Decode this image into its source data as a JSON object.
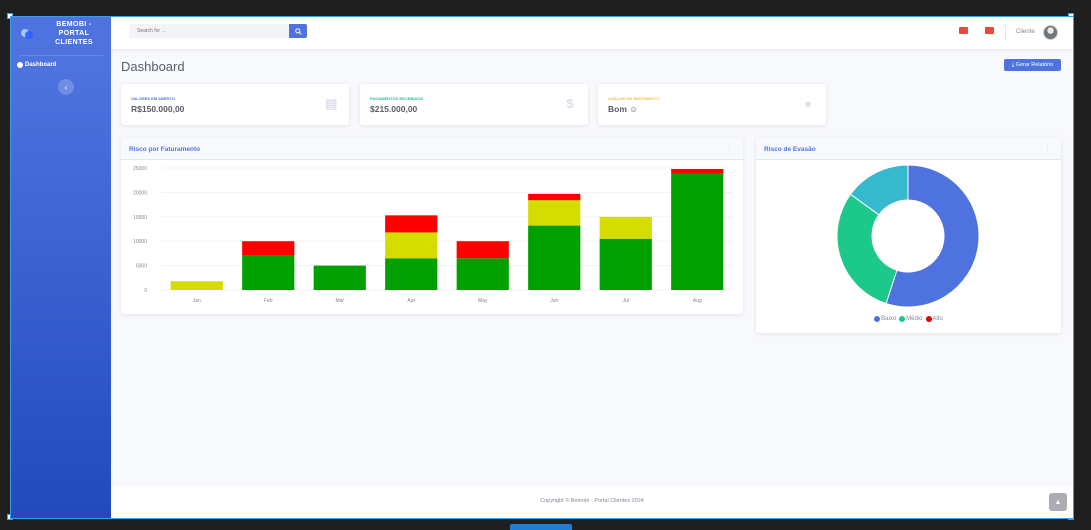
{
  "sidebar": {
    "brand": "BEMOBI - PORTAL CLIENTES",
    "nav_items": [
      {
        "label": "Dashboard",
        "icon": "dashboard-icon",
        "active": true
      }
    ],
    "toggle_icon": "chevron-left-icon"
  },
  "topbar": {
    "search_placeholder": "Search for ...",
    "user_name": "Cliente",
    "icons": [
      "search-icon",
      "alert-icon",
      "message-icon"
    ]
  },
  "header": {
    "title": "Dashboard",
    "report_button": "⤓ Gerar Relatório"
  },
  "kpis": [
    {
      "label": "VALORES EM ABERTO",
      "value": "R$150.000,00",
      "icon": "calendar-icon",
      "color": "#4e73df"
    },
    {
      "label": "PAGAMENTOS RECEBIDOS",
      "value": "$215.000,00",
      "icon": "dollar-icon",
      "color": "#1cc88a"
    },
    {
      "label": "ANÁLISE DE SENTIMENTO",
      "value": "Bom ☺",
      "icon": "comments-icon",
      "color": "#f6c23e"
    }
  ],
  "bar_panel": {
    "title": "Risco por Faturamento",
    "menu": "⋮"
  },
  "donut_panel": {
    "title": "Risco de Evasão",
    "menu": "⋮"
  },
  "chart_data": [
    {
      "type": "bar",
      "stacked": true,
      "title": "Risco por Faturamento",
      "categories": [
        "Jan",
        "Feb",
        "Mar",
        "Apr",
        "May",
        "Jun",
        "Jul",
        "Aug"
      ],
      "series": [
        {
          "color": "#00a000",
          "values": [
            0,
            7000,
            5000,
            6500,
            6500,
            13200,
            10500,
            23800
          ]
        },
        {
          "color": "#d4dc00",
          "values": [
            1800,
            0,
            0,
            5300,
            0,
            5200,
            4500,
            0
          ]
        },
        {
          "color": "#ff0000",
          "values": [
            0,
            3000,
            0,
            3500,
            3500,
            1300,
            0,
            1000
          ]
        }
      ],
      "ylim": [
        0,
        25000
      ],
      "yticks": [
        0,
        5000,
        10000,
        15000,
        20000,
        25000
      ],
      "grid": true
    },
    {
      "type": "pie",
      "donut": true,
      "title": "Risco de Evasão",
      "labels": [
        "Baixo",
        "Médio",
        "Alto"
      ],
      "values": [
        55,
        30,
        15
      ],
      "colors": [
        "#4e73df",
        "#1cc88a",
        "#36b9cc"
      ],
      "legend_colors": [
        "#4e73df",
        "#1cc88a",
        "#e00000"
      ],
      "legend_position": "bottom"
    }
  ],
  "footer": {
    "text": "Copyright © Bemobi - Portal Clientes 2024"
  }
}
